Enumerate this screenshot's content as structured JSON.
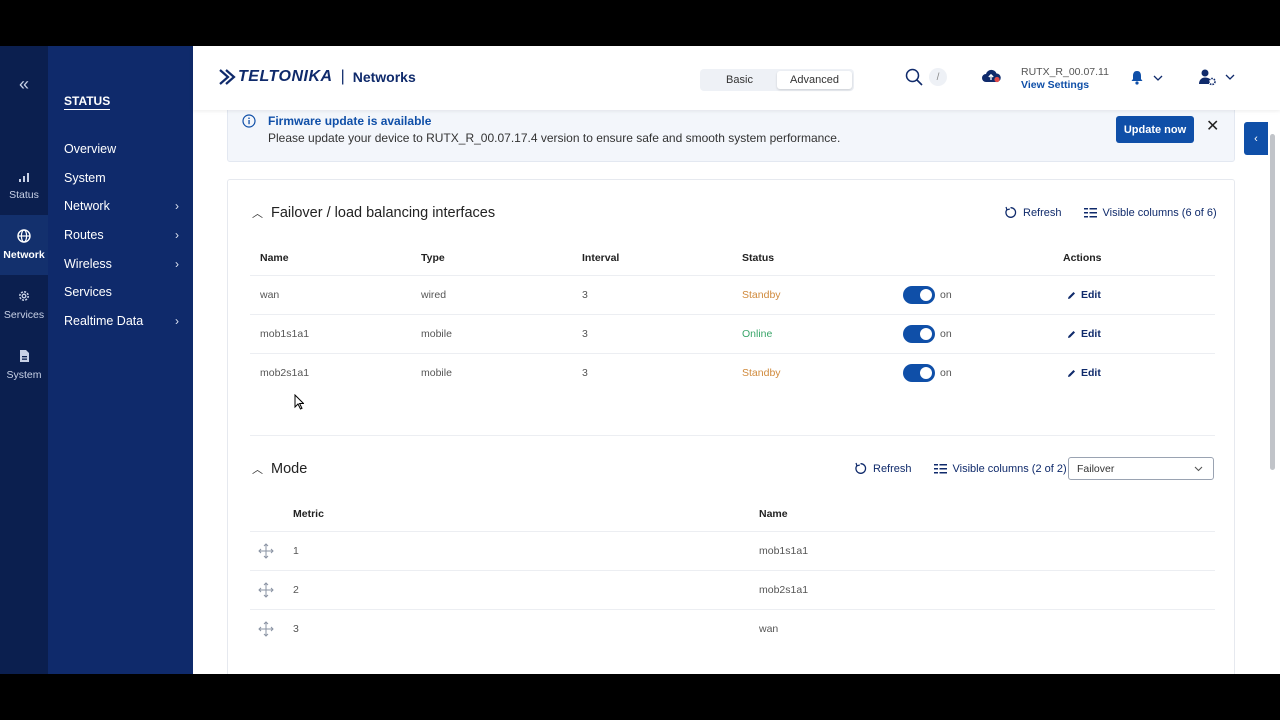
{
  "rail": {
    "collapse_glyph": "«",
    "items": [
      {
        "label": "Status",
        "icon": "signal-bars-icon"
      },
      {
        "label": "Network",
        "icon": "globe-icon"
      },
      {
        "label": "Services",
        "icon": "gear-icon"
      },
      {
        "label": "System",
        "icon": "file-icon"
      }
    ]
  },
  "nav": {
    "section_title": "STATUS",
    "items": [
      {
        "label": "Overview",
        "has_children": false
      },
      {
        "label": "System",
        "has_children": false
      },
      {
        "label": "Network",
        "has_children": true
      },
      {
        "label": "Routes",
        "has_children": true
      },
      {
        "label": "Wireless",
        "has_children": true
      },
      {
        "label": "Services",
        "has_children": false
      },
      {
        "label": "Realtime Data",
        "has_children": true
      }
    ]
  },
  "header": {
    "logo_text": "TELTONIKA",
    "logo_separator": "|",
    "logo_product": "Networks",
    "mode_basic": "Basic",
    "mode_advanced": "Advanced",
    "selected_mode": "Advanced",
    "search_shortcut": "/",
    "firmware_version": "RUTX_R_00.07.11",
    "view_settings": "View Settings"
  },
  "banner": {
    "title": "Firmware update is available",
    "text": "Please update your device to RUTX_R_00.07.17.4 version to ensure safe and smooth system performance.",
    "button": "Update now",
    "close": "✕"
  },
  "failover": {
    "title": "Failover / load balancing interfaces",
    "refresh": "Refresh",
    "visible_columns": "Visible columns (6 of 6)",
    "columns": {
      "name": "Name",
      "type": "Type",
      "interval": "Interval",
      "status": "Status",
      "actions": "Actions"
    },
    "rows": [
      {
        "name": "wan",
        "type": "wired",
        "interval": "3",
        "status": "Standby",
        "enabled": "on",
        "action": "Edit"
      },
      {
        "name": "mob1s1a1",
        "type": "mobile",
        "interval": "3",
        "status": "Online",
        "enabled": "on",
        "action": "Edit"
      },
      {
        "name": "mob2s1a1",
        "type": "mobile",
        "interval": "3",
        "status": "Standby",
        "enabled": "on",
        "action": "Edit"
      }
    ]
  },
  "mode": {
    "title": "Mode",
    "refresh": "Refresh",
    "visible_columns": "Visible columns (2 of 2)",
    "selected": "Failover",
    "columns": {
      "metric": "Metric",
      "name": "Name"
    },
    "rows": [
      {
        "metric": "1",
        "name": "mob1s1a1"
      },
      {
        "metric": "2",
        "name": "mob2s1a1"
      },
      {
        "metric": "3",
        "name": "wan"
      }
    ]
  },
  "colors": {
    "rail_bg": "#0b1f4f",
    "nav_bg": "#0f2a6b",
    "accent": "#0f4fa8",
    "standby": "#d08a3c",
    "online": "#3aa66a"
  }
}
